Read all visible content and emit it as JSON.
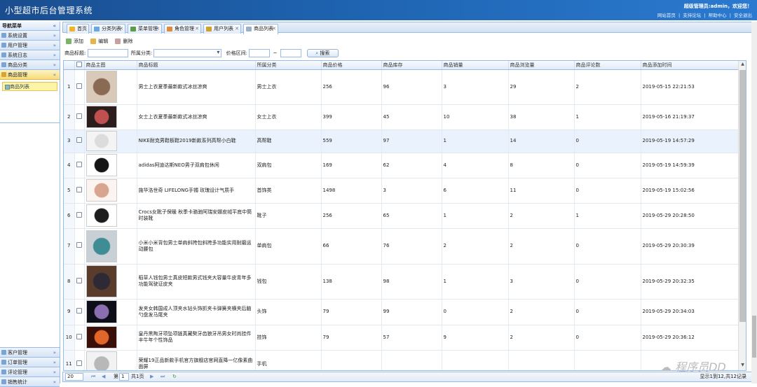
{
  "header": {
    "title": "小型超市后台管理系统",
    "welcome": "超级管理员:admin，欢迎您！",
    "links": [
      "网站首页",
      "支持论坛",
      "帮助中心",
      "安全退出"
    ],
    "separator": "|"
  },
  "sidebar": {
    "title": "导航菜单",
    "collapse_glyph": "«",
    "expand_glyph": "»",
    "top_items": [
      {
        "label": "系统设置"
      },
      {
        "label": "用户管理"
      },
      {
        "label": "系统日志"
      },
      {
        "label": "商品分类"
      },
      {
        "label": "商品管理",
        "active": true
      }
    ],
    "active_sub": "商品列表",
    "bottom_items": [
      {
        "label": "客户管理"
      },
      {
        "label": "订单管理"
      },
      {
        "label": "评论管理"
      },
      {
        "label": "销售统计"
      }
    ]
  },
  "tabs": [
    {
      "label": "首页",
      "color": "#f0b429",
      "closable": false
    },
    {
      "label": "分类列表",
      "color": "#6aa7e0",
      "closable": true
    },
    {
      "label": "菜单管理",
      "color": "#5d9d4a",
      "closable": true
    },
    {
      "label": "角色管理",
      "color": "#e08a3c",
      "closable": true
    },
    {
      "label": "用户列表",
      "color": "#d0a030",
      "closable": true
    },
    {
      "label": "商品列表",
      "color": "#9ab0c8",
      "closable": true,
      "active": true
    }
  ],
  "toolbar": {
    "add": "添加",
    "edit": "编辑",
    "delete": "删除"
  },
  "filters": {
    "title_label": "商品标题:",
    "category_label": "所属分类:",
    "price_label": "价格区间:",
    "range_sep": "~",
    "search": "搜索"
  },
  "columns": [
    "商品主图",
    "商品标题",
    "所属分类",
    "商品价格",
    "商品库存",
    "商品销量",
    "商品浏览量",
    "商品评论数",
    "商品添加时间"
  ],
  "rows": [
    {
      "n": "1",
      "title": "男士上衣夏季最新款式冰丝凉爽",
      "cat": "男士上衣",
      "price": "256",
      "stock": "96",
      "sales": "3",
      "views": "29",
      "comments": "2",
      "time": "2019-05-15 22:21:53",
      "img": [
        "#d9c9b8",
        "#8a6a55"
      ]
    },
    {
      "n": "2",
      "title": "女士上衣夏季最新款式冰丝凉爽",
      "cat": "女士上衣",
      "price": "399",
      "stock": "45",
      "sales": "10",
      "views": "38",
      "comments": "1",
      "time": "2019-05-16 21:19:37",
      "img": [
        "#2a1d1c",
        "#c05050"
      ]
    },
    {
      "n": "3",
      "title": "NIKE耐克男鞋板鞋2019新款系列高帮小白鞋",
      "cat": "高帮鞋",
      "price": "559",
      "stock": "97",
      "sales": "1",
      "views": "14",
      "comments": "0",
      "time": "2019-05-19 14:57:29",
      "img": [
        "#f4f4f4",
        "#dcdcdc"
      ]
    },
    {
      "n": "4",
      "title": "adidas阿迪达斯NEO男子双肩包休闲",
      "cat": "双肩包",
      "price": "169",
      "stock": "62",
      "sales": "4",
      "views": "8",
      "comments": "0",
      "time": "2019-05-19 14:59:39",
      "img": [
        "#ffffff",
        "#151515"
      ]
    },
    {
      "n": "5",
      "title": "施华洛世奇 LIFELONG手镯 玫瑰设计气质手",
      "cat": "首饰类",
      "price": "1498",
      "stock": "3",
      "sales": "6",
      "views": "11",
      "comments": "0",
      "time": "2019-05-19 15:02:56",
      "img": [
        "#fbf4f0",
        "#d8a58f"
      ]
    },
    {
      "n": "6",
      "title": "Crocs女靴子保暖 秋季卡骆驰阿瑞安娜皮绒平底中筒时装靴",
      "cat": "靴子",
      "price": "256",
      "stock": "65",
      "sales": "1",
      "views": "2",
      "comments": "1",
      "time": "2019-05-29 20:28:50",
      "img": [
        "#ffffff",
        "#1d1d1d"
      ]
    },
    {
      "n": "7",
      "title": "小米小米背包男士单肩斜挎包斜挎多功能实用耐磨运动腰包",
      "cat": "单肩包",
      "price": "66",
      "stock": "76",
      "sales": "2",
      "views": "2",
      "comments": "0",
      "time": "2019-05-29 20:30:39",
      "img": [
        "#c8d0d6",
        "#3e8c94"
      ]
    },
    {
      "n": "8",
      "title": "稻草人钱包男士真皮短款男式钱夹大容量牛皮青年多功能驾驶证皮夹",
      "cat": "钱包",
      "price": "138",
      "stock": "98",
      "sales": "1",
      "views": "3",
      "comments": "0",
      "time": "2019-05-29 20:32:35",
      "img": [
        "#5a3c2c",
        "#2d2a35"
      ]
    },
    {
      "n": "9",
      "title": "发夹女韩国成人顶夹水钻头饰抓夹卡弹簧夹横夹后脑勺盘发马尾夹",
      "cat": "头饰",
      "price": "79",
      "stock": "99",
      "sales": "0",
      "views": "2",
      "comments": "0",
      "time": "2019-05-29 20:34:03",
      "img": [
        "#0e0e18",
        "#8a6fb0"
      ]
    },
    {
      "n": "10",
      "title": "皇丹黑陶牙项坠项链真藏獒牙齿狼牙吊男女时尚挂件丰牛年个性饰品",
      "cat": "挂饰",
      "price": "79",
      "stock": "57",
      "sales": "9",
      "views": "2",
      "comments": "0",
      "time": "2019-05-29 20:36:12",
      "img": [
        "#3a0f08",
        "#e0662a"
      ]
    },
    {
      "n": "11",
      "title": "荣耀19正品新款手机官方旗舰店官网直降一亿像素曲面屏",
      "cat": "手机",
      "price": "",
      "stock": "",
      "sales": "",
      "views": "",
      "comments": "",
      "time": "",
      "img": [
        "#f2f2f2",
        "#b8b8b8"
      ]
    }
  ],
  "pager": {
    "page_size": "20",
    "page_label": "第",
    "page": "1",
    "total_pages": "共1页",
    "summary": "显示1到12,共12记录"
  },
  "watermark": "程序员DD"
}
